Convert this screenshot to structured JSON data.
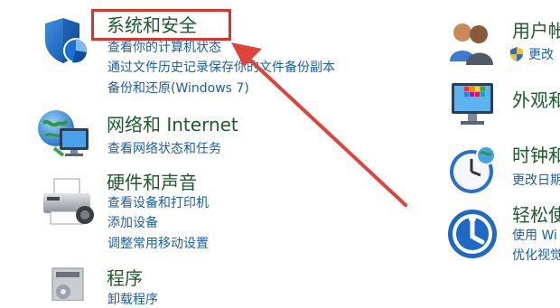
{
  "colors": {
    "title": "#1e5b2c",
    "link": "#1a5fa8",
    "highlight": "#d9332b",
    "arrow": "#e0433a"
  },
  "left": {
    "system_security": {
      "title": "系统和安全",
      "links": [
        "查看你的计算机状态",
        "通过文件历史记录保存你的文件备份副本",
        "备份和还原(Windows 7)"
      ],
      "icon": "shield-icon"
    },
    "network": {
      "title": "网络和 Internet",
      "links": [
        "查看网络状态和任务"
      ],
      "icon": "network-globe-icon"
    },
    "hardware": {
      "title": "硬件和声音",
      "links": [
        "查看设备和打印机",
        "添加设备",
        "调整常用移动设置"
      ],
      "icon": "printer-icon"
    },
    "programs": {
      "title": "程序",
      "links": [
        "卸载程序"
      ],
      "icon": "programs-icon"
    }
  },
  "right": {
    "user_accounts": {
      "title": "用户帐",
      "links": [
        "更改"
      ],
      "icon": "users-icon"
    },
    "appearance": {
      "title": "外观和",
      "icon": "appearance-icon"
    },
    "clock": {
      "title": "时钟和",
      "links": [
        "更改日期"
      ],
      "icon": "clock-icon"
    },
    "ease": {
      "title": "轻松使",
      "links": [
        "使用 Wi",
        "优化视觉"
      ],
      "icon": "ease-of-access-icon"
    }
  }
}
